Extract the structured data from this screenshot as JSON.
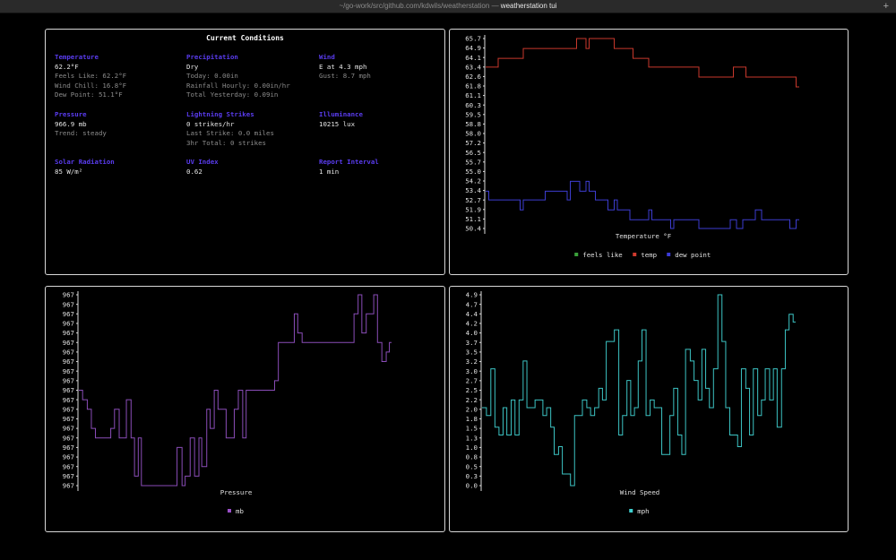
{
  "window": {
    "path": "~/go-work/src/github.com/kdwils/weatherstation",
    "separator": " — ",
    "title": "weatherstation tui",
    "new_tab": "+"
  },
  "conditions": {
    "title": "Current Conditions",
    "columns": [
      [
        {
          "heading": "Temperature",
          "value": "62.2°F",
          "details": [
            "Feels Like: 62.2°F",
            "Wind Chill: 16.8°F",
            "Dew Point: 51.1°F"
          ]
        },
        {
          "heading": "Pressure",
          "value": "966.9 mb",
          "details": [
            "Trend: steady"
          ]
        },
        {
          "heading": "Solar Radiation",
          "value": "85 W/m²",
          "details": []
        }
      ],
      [
        {
          "heading": "Precipitation",
          "value": "Dry",
          "details": [
            "Today: 0.00in",
            "Rainfall Hourly: 0.00in/hr",
            "Total Yesterday: 0.09in"
          ]
        },
        {
          "heading": "Lightning Strikes",
          "value": "0 strikes/hr",
          "details": [
            "Last Strike: 0.0 miles",
            "3hr Total: 0 strikes"
          ]
        },
        {
          "heading": "UV Index",
          "value": "0.62",
          "details": []
        }
      ],
      [
        {
          "heading": "Wind",
          "value": "E at 4.3 mph",
          "details": [
            "Gust: 8.7 mph"
          ]
        },
        {
          "heading": "Illuminance",
          "value": "10215 lux",
          "details": []
        },
        {
          "heading": "Report Interval",
          "value": "1 min",
          "details": []
        }
      ]
    ]
  },
  "chart_data": [
    {
      "id": "temp",
      "type": "line",
      "step": true,
      "title": "Temperature °F",
      "ylim": [
        50.4,
        65.7
      ],
      "yticks": [
        "65.7",
        "64.9",
        "64.1",
        "63.4",
        "62.6",
        "61.8",
        "61.1",
        "60.3",
        "59.5",
        "58.8",
        "58.0",
        "57.2",
        "56.5",
        "55.7",
        "55.0",
        "54.2",
        "53.4",
        "52.7",
        "51.9",
        "51.1",
        "50.4"
      ],
      "legend": [
        {
          "name": "feels like",
          "color": "#3aa23a"
        },
        {
          "name": "temp",
          "color": "#d03a2e"
        },
        {
          "name": "dew point",
          "color": "#3b3bd8"
        }
      ],
      "series": [
        {
          "name": "temp",
          "color": "#c8382c",
          "points": [
            [
              0,
              63.4
            ],
            [
              4,
              64.1
            ],
            [
              12,
              64.9
            ],
            [
              29,
              65.7
            ],
            [
              32,
              64.9
            ],
            [
              33,
              65.7
            ],
            [
              41,
              64.9
            ],
            [
              47,
              64.1
            ],
            [
              52,
              63.4
            ],
            [
              68,
              62.6
            ],
            [
              79,
              63.4
            ],
            [
              83,
              62.6
            ],
            [
              99,
              61.8
            ],
            [
              100,
              61.8
            ]
          ]
        },
        {
          "name": "dew point",
          "color": "#3d3dd0",
          "points": [
            [
              0,
              53.4
            ],
            [
              1,
              52.7
            ],
            [
              11,
              51.9
            ],
            [
              12,
              52.7
            ],
            [
              19,
              53.4
            ],
            [
              26,
              52.7
            ],
            [
              27,
              54.2
            ],
            [
              30,
              53.4
            ],
            [
              32,
              54.2
            ],
            [
              33,
              53.4
            ],
            [
              35,
              52.7
            ],
            [
              39,
              51.9
            ],
            [
              41,
              52.7
            ],
            [
              42,
              51.9
            ],
            [
              46,
              51.1
            ],
            [
              52,
              51.9
            ],
            [
              53,
              51.1
            ],
            [
              59,
              50.4
            ],
            [
              60,
              51.1
            ],
            [
              68,
              50.4
            ],
            [
              78,
              51.1
            ],
            [
              80,
              50.4
            ],
            [
              82,
              51.1
            ],
            [
              86,
              51.9
            ],
            [
              88,
              51.1
            ],
            [
              97,
              50.4
            ],
            [
              99,
              51.1
            ],
            [
              100,
              51.1
            ]
          ]
        }
      ]
    },
    {
      "id": "pres",
      "type": "line",
      "step": true,
      "title": "Pressure",
      "ylim": [
        0,
        20
      ],
      "yticks": [
        "967",
        "967",
        "967",
        "967",
        "967",
        "967",
        "967",
        "967",
        "967",
        "967",
        "967",
        "967",
        "967",
        "967",
        "967",
        "967",
        "967",
        "967",
        "967",
        "967",
        "967"
      ],
      "legend": [
        {
          "name": "mb",
          "color": "#9a4fc8"
        }
      ],
      "series": [
        {
          "name": "mb",
          "color": "#8a4db8",
          "points": [
            [
              0,
              10
            ],
            [
              1.2,
              9
            ],
            [
              2.7,
              8
            ],
            [
              4,
              6
            ],
            [
              5.3,
              5
            ],
            [
              10.2,
              6
            ],
            [
              11.4,
              8
            ],
            [
              12.9,
              5
            ],
            [
              15.2,
              9
            ],
            [
              16.7,
              5
            ],
            [
              17.8,
              1
            ],
            [
              19,
              5
            ],
            [
              20,
              0
            ],
            [
              31.4,
              4
            ],
            [
              33,
              0
            ],
            [
              34,
              1
            ],
            [
              35.6,
              5
            ],
            [
              37,
              1
            ],
            [
              38.4,
              5
            ],
            [
              39.3,
              2
            ],
            [
              40.9,
              8
            ],
            [
              42,
              6
            ],
            [
              43.3,
              10
            ],
            [
              44.5,
              8
            ],
            [
              47.1,
              5
            ],
            [
              49.7,
              8
            ],
            [
              51,
              10
            ],
            [
              52.4,
              5
            ],
            [
              53.5,
              10
            ],
            [
              62.6,
              11
            ],
            [
              63.8,
              15
            ],
            [
              68.9,
              18
            ],
            [
              70,
              16
            ],
            [
              71.4,
              15
            ],
            [
              88,
              18
            ],
            [
              89.3,
              20
            ],
            [
              90.5,
              16
            ],
            [
              91.9,
              18
            ],
            [
              94.3,
              20
            ],
            [
              95.5,
              15
            ],
            [
              96.9,
              13
            ],
            [
              98.3,
              14
            ],
            [
              99.3,
              15
            ],
            [
              100,
              15
            ]
          ]
        }
      ]
    },
    {
      "id": "wind",
      "type": "line",
      "step": true,
      "title": "Wind Speed",
      "ylim": [
        0,
        4.9
      ],
      "yticks": [
        "4.9",
        "4.7",
        "4.4",
        "4.2",
        "4.0",
        "3.7",
        "3.5",
        "3.2",
        "3.0",
        "2.7",
        "2.5",
        "2.2",
        "2.0",
        "1.8",
        "1.5",
        "1.3",
        "1.0",
        "0.8",
        "0.5",
        "0.3",
        "0.0"
      ],
      "legend": [
        {
          "name": "mph",
          "color": "#3fd0d0"
        }
      ],
      "series": [
        {
          "name": "mph",
          "color": "#3cc4c4",
          "points": [
            [
              0,
              2.0
            ],
            [
              1.4,
              1.8
            ],
            [
              2.8,
              3.0
            ],
            [
              4.1,
              1.5
            ],
            [
              5.4,
              1.3
            ],
            [
              6.7,
              2.0
            ],
            [
              7.9,
              1.3
            ],
            [
              9.3,
              2.2
            ],
            [
              10.5,
              1.3
            ],
            [
              11.8,
              2.2
            ],
            [
              13.1,
              3.2
            ],
            [
              14.3,
              2.0
            ],
            [
              16.9,
              2.2
            ],
            [
              19.4,
              1.8
            ],
            [
              20.6,
              2.0
            ],
            [
              21.9,
              1.5
            ],
            [
              23,
              0.8
            ],
            [
              24.4,
              1.0
            ],
            [
              25.6,
              0.3
            ],
            [
              28.2,
              0.0
            ],
            [
              29.5,
              1.8
            ],
            [
              32,
              2.2
            ],
            [
              33.4,
              2.0
            ],
            [
              34.6,
              1.8
            ],
            [
              35.9,
              2.0
            ],
            [
              37.2,
              2.5
            ],
            [
              38.4,
              2.2
            ],
            [
              39.6,
              3.7
            ],
            [
              42.2,
              4.0
            ],
            [
              43.6,
              1.3
            ],
            [
              44.8,
              1.8
            ],
            [
              46.2,
              2.7
            ],
            [
              47.4,
              1.8
            ],
            [
              48.6,
              2.0
            ],
            [
              49.8,
              3.2
            ],
            [
              51,
              4.0
            ],
            [
              52.3,
              1.8
            ],
            [
              53.6,
              2.2
            ],
            [
              54.9,
              2.0
            ],
            [
              57.3,
              0.8
            ],
            [
              59.9,
              1.8
            ],
            [
              61.1,
              2.5
            ],
            [
              62.4,
              1.3
            ],
            [
              63.7,
              0.8
            ],
            [
              64.9,
              3.5
            ],
            [
              66.4,
              3.2
            ],
            [
              67.6,
              2.7
            ],
            [
              68.9,
              2.2
            ],
            [
              70.1,
              3.5
            ],
            [
              71.3,
              2.5
            ],
            [
              72.5,
              2.0
            ],
            [
              73.8,
              3.0
            ],
            [
              75.2,
              4.9
            ],
            [
              76.5,
              3.7
            ],
            [
              77.7,
              2.0
            ],
            [
              79,
              1.3
            ],
            [
              81.5,
              1.0
            ],
            [
              82.7,
              3.0
            ],
            [
              84.1,
              2.5
            ],
            [
              85.3,
              1.3
            ],
            [
              86.5,
              3.0
            ],
            [
              87.9,
              1.8
            ],
            [
              89.1,
              2.2
            ],
            [
              90.3,
              3.0
            ],
            [
              91.7,
              2.2
            ],
            [
              92.9,
              3.0
            ],
            [
              94.1,
              1.5
            ],
            [
              95.5,
              3.0
            ],
            [
              96.7,
              4.0
            ],
            [
              97.9,
              4.4
            ],
            [
              99.2,
              4.2
            ],
            [
              100,
              4.2
            ]
          ]
        }
      ]
    }
  ]
}
